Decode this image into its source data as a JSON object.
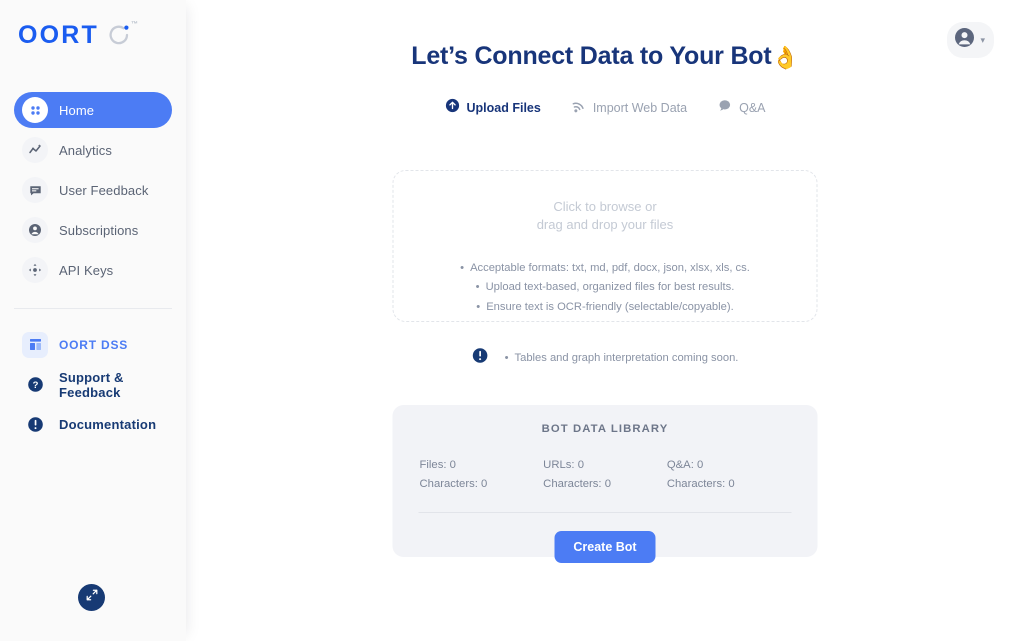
{
  "brand": {
    "name": "OORT",
    "trademark": "™",
    "logo_color": "#1a5cf0",
    "logo_ring_color": "#c7ccd6"
  },
  "sidebar": {
    "items": [
      {
        "label": "Home",
        "icon": "grid-icon",
        "active": true
      },
      {
        "label": "Analytics",
        "icon": "analytics-icon",
        "active": false
      },
      {
        "label": "User Feedback",
        "icon": "chat-icon",
        "active": false
      },
      {
        "label": "Subscriptions",
        "icon": "person-icon",
        "active": false
      },
      {
        "label": "API Keys",
        "icon": "api-keys-icon",
        "active": false
      }
    ],
    "secondary_items": [
      {
        "label": "OORT DSS",
        "icon": "dashboard-icon",
        "style": "blue"
      },
      {
        "label": "Support & Feedback",
        "icon": "help-circle-icon",
        "style": "navy"
      },
      {
        "label": "Documentation",
        "icon": "info-circle-icon",
        "style": "navy"
      }
    ],
    "collapse_button": {
      "icon": "collapse-arrows-icon"
    },
    "active_color": "#4c7cf4"
  },
  "header": {
    "avatar_button": {
      "icon": "account-circle-icon",
      "chevron": "chevron-down-icon",
      "caret": "▾"
    }
  },
  "main": {
    "title": "Let’s Connect Data to Your Bot",
    "title_emoji": "👌",
    "tabs": [
      {
        "label": "Upload Files",
        "icon": "upload-circle-icon",
        "active": true
      },
      {
        "label": "Import Web Data",
        "icon": "rss-signal-icon",
        "active": false
      },
      {
        "label": "Q&A",
        "icon": "chat-bubble-icon",
        "active": false
      }
    ],
    "dropzone": {
      "line1": "Click to browse or",
      "line2": "drag and drop your files",
      "bullets": [
        "Acceptable formats: txt, md, pdf, docx, json, xlsx, xls, cs.",
        "Upload text-based, organized files for best results.",
        "Ensure text is OCR-friendly (selectable/copyable)."
      ]
    },
    "note": {
      "icon": "info-circle-icon",
      "text": "Tables and graph interpretation coming soon."
    },
    "library": {
      "title": "BOT DATA LIBRARY",
      "columns": [
        {
          "count_label": "Files: 0",
          "chars_label": "Characters: 0"
        },
        {
          "count_label": "URLs: 0",
          "chars_label": "Characters: 0"
        },
        {
          "count_label": "Q&A: 0",
          "chars_label": "Characters: 0"
        }
      ],
      "create_button": "Create Bot"
    }
  }
}
